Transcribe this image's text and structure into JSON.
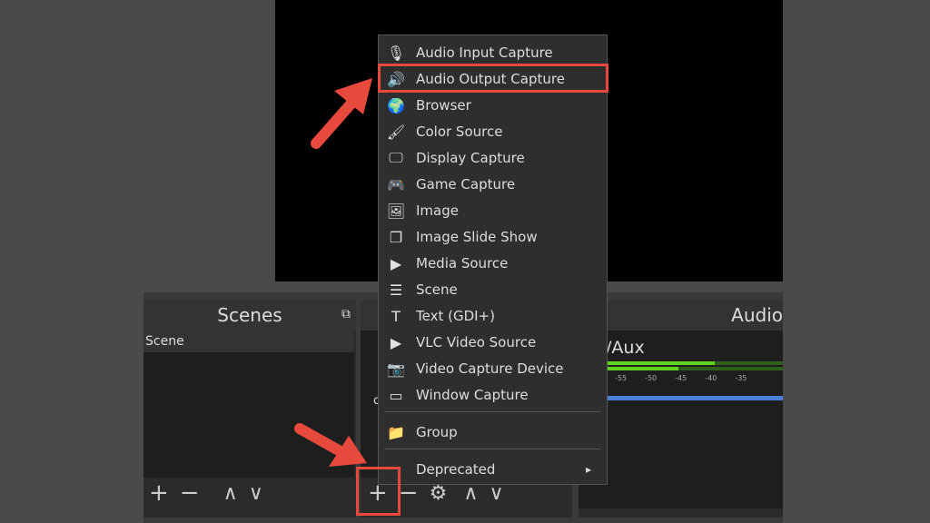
{
  "scenes": {
    "title": "Scenes",
    "items": [
      "Scene"
    ]
  },
  "audio": {
    "title": "Audio",
    "channel": "/Aux",
    "ticks": [
      "-55",
      "-50",
      "-45",
      "-40",
      "-35"
    ]
  },
  "sources": {
    "partial": "c"
  },
  "menu": {
    "items": [
      {
        "icon": "microphone-icon",
        "glyph": "🎙",
        "label": "Audio Input Capture"
      },
      {
        "icon": "speaker-icon",
        "glyph": "🔊",
        "label": "Audio Output Capture"
      },
      {
        "icon": "globe-icon",
        "glyph": "🌍",
        "label": "Browser"
      },
      {
        "icon": "brush-icon",
        "glyph": "🖌",
        "label": "Color Source"
      },
      {
        "icon": "monitor-icon",
        "glyph": "🖵",
        "label": "Display Capture"
      },
      {
        "icon": "gamepad-icon",
        "glyph": "🎮",
        "label": "Game Capture"
      },
      {
        "icon": "image-icon",
        "glyph": "🖼",
        "label": "Image"
      },
      {
        "icon": "slideshow-icon",
        "glyph": "❐",
        "label": "Image Slide Show"
      },
      {
        "icon": "play-icon",
        "glyph": "▶",
        "label": "Media Source"
      },
      {
        "icon": "list-icon",
        "glyph": "☰",
        "label": "Scene"
      },
      {
        "icon": "text-icon",
        "glyph": "T",
        "label": "Text (GDI+)"
      },
      {
        "icon": "play-icon",
        "glyph": "▶",
        "label": "VLC Video Source"
      },
      {
        "icon": "camera-icon",
        "glyph": "📷",
        "label": "Video Capture Device"
      },
      {
        "icon": "window-icon",
        "glyph": "▭",
        "label": "Window Capture"
      }
    ],
    "group": {
      "icon": "folder-icon",
      "glyph": "📁",
      "label": "Group"
    },
    "deprecated": {
      "label": "Deprecated",
      "arrow": "▸"
    }
  },
  "toolbar": {
    "add": "+",
    "remove": "−",
    "up": "∧",
    "down": "∨",
    "settings": "⚙"
  },
  "colors": {
    "highlight": "#e8493d",
    "meter_green": "#5fd11e",
    "meter_blue": "#4a7fd8"
  }
}
